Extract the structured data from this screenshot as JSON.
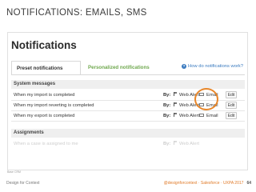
{
  "slide": {
    "title": "NOTIFICATIONS: EMAILS, SMS"
  },
  "app": {
    "title": "Notifications"
  },
  "tabs": [
    {
      "label": "Preset notifications"
    },
    {
      "label": "Personalized notifications"
    }
  ],
  "help": {
    "label": "How do notifications work?",
    "icon": "question-circle-icon"
  },
  "sections": {
    "system": {
      "label": "System messages"
    },
    "assignments": {
      "label": "Assignments"
    }
  },
  "rows": [
    {
      "label": "When my import is completed",
      "by": "By:",
      "web": "Web Alert",
      "email": "Email",
      "edit": "Edit"
    },
    {
      "label": "When my import reverting is completed",
      "by": "By:",
      "web": "Web Alert",
      "email": "Email",
      "edit": "Edit"
    },
    {
      "label": "When my export is completed",
      "by": "By:",
      "web": "Web Alert",
      "email": "Email",
      "edit": "Edit"
    }
  ],
  "faded_row": {
    "label": "When a case is assigned to me",
    "by": "By:",
    "web": "Web Alert"
  },
  "attribution": "Base CRM",
  "footer": {
    "left": "Design for Context",
    "right": "@designforcontext · Salesforce · UXPA 2017",
    "page": "64"
  },
  "colors": {
    "accent": "#e8872a",
    "link": "#3a7abf",
    "tab_green": "#6fa84e"
  }
}
